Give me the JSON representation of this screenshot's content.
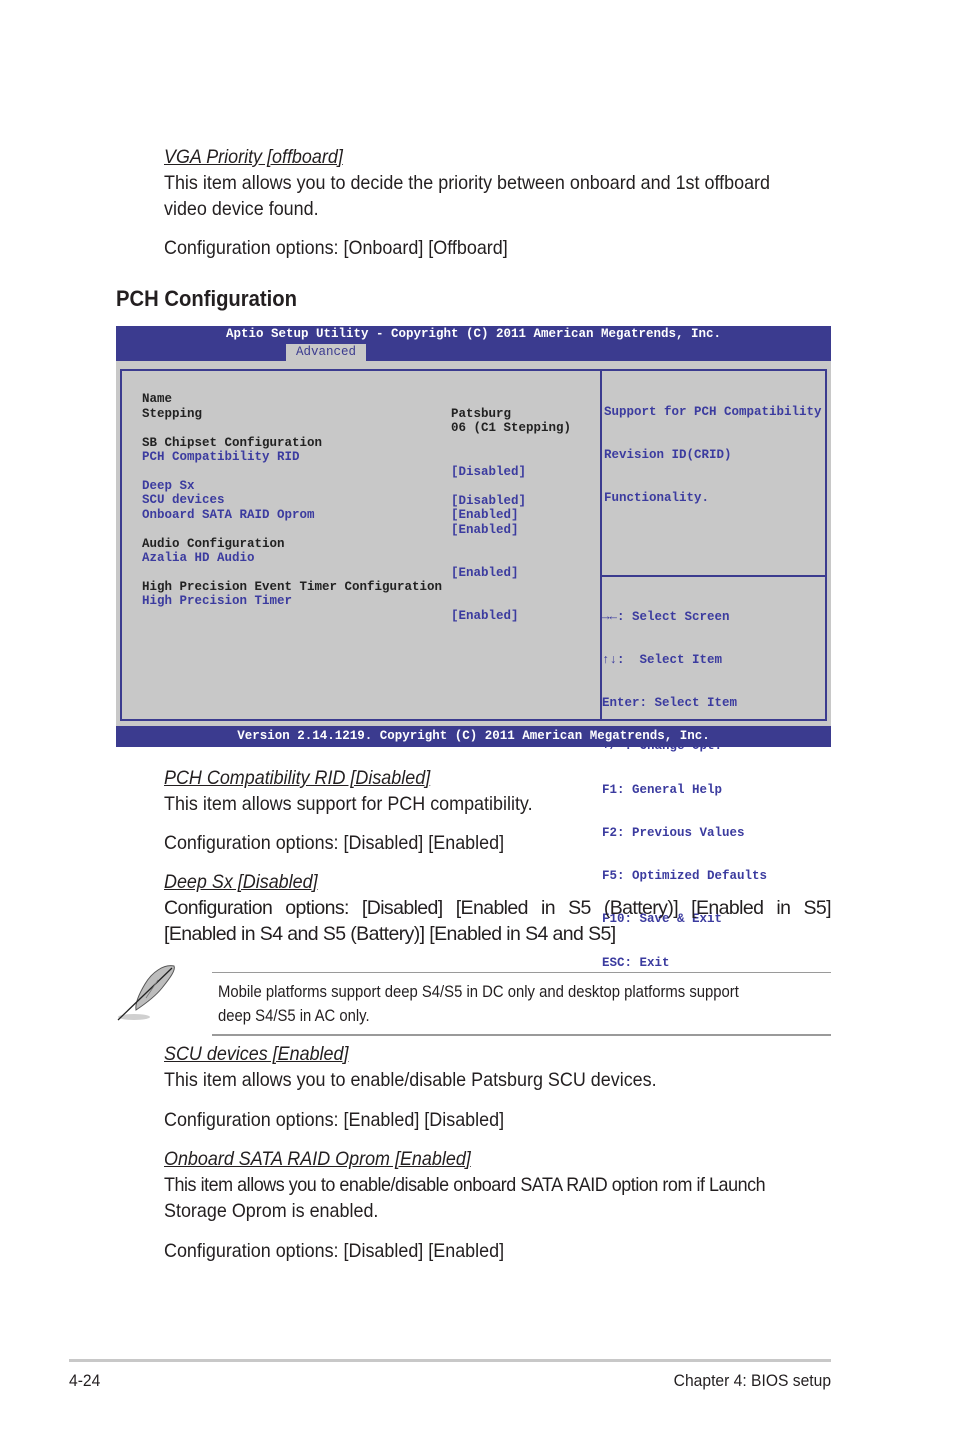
{
  "vga": {
    "title": "VGA Priority [offboard]",
    "desc_line1": "This item allows you to decide the priority between onboard and 1st offboard",
    "desc_line2": "video device found.",
    "options": "Configuration options: [Onboard] [Offboard]"
  },
  "section_heading": "PCH Configuration",
  "bios": {
    "title": "Aptio Setup Utility - Copyright (C) 2011 American Megatrends, Inc.",
    "active_tab": "Advanced",
    "rows": [
      {
        "label": "Name",
        "value": "Patsburg",
        "selectable": false
      },
      {
        "label": "Stepping",
        "value": "06 (C1 Stepping)",
        "selectable": false
      },
      {
        "label": "SB Chipset Configuration",
        "value": "",
        "selectable": false
      },
      {
        "label": "PCH Compatibility RID",
        "value": "[Disabled]",
        "selectable": true
      },
      {
        "label": "Deep Sx",
        "value": "[Disabled]",
        "selectable": true
      },
      {
        "label": "SCU devices",
        "value": "[Enabled]",
        "selectable": true
      },
      {
        "label": "Onboard SATA RAID Oprom",
        "value": "[Enabled]",
        "selectable": true
      },
      {
        "label": "Audio Configuration",
        "value": "",
        "selectable": false
      },
      {
        "label": "Azalia HD Audio",
        "value": "[Enabled]",
        "selectable": true
      },
      {
        "label": "High Precision Event Timer Configuration",
        "value": "",
        "selectable": false
      },
      {
        "label": "High Precision Timer",
        "value": "[Enabled]",
        "selectable": true
      }
    ],
    "help_lines": [
      "Support for PCH Compatibility",
      "Revision ID(CRID)",
      "Functionality."
    ],
    "key_hints": [
      "→←: Select Screen",
      "↑↓:  Select Item",
      "Enter: Select Item",
      "+/-: Change Opt.",
      "F1: General Help",
      "F2: Previous Values",
      "F5: Optimized Defaults",
      "F10: Save & Exit",
      "ESC: Exit"
    ],
    "version": "Version 2.14.1219. Copyright (C) 2011 American Megatrends, Inc.",
    "colors": {
      "bar": "#3b3b8f",
      "panel": "#c8c8c8",
      "selectable_text": "#3b3b9f"
    }
  },
  "pch_rid": {
    "title": "PCH Compatibility RID [Disabled]",
    "desc": "This item allows support for PCH compatibility.",
    "options": "Configuration options: [Disabled] [Enabled]"
  },
  "deep_sx": {
    "title": "Deep Sx [Disabled]",
    "options": "Configuration options: [Disabled] [Enabled in S5 (Battery)] [Enabled in S5] [Enabled in S4 and S5 (Battery)] [Enabled in S4 and S5]"
  },
  "note": {
    "icon": "feather-pen-icon",
    "text_line1": "Mobile platforms support deep S4/S5 in DC only and desktop platforms support",
    "text_line2": "deep S4/S5 in AC only."
  },
  "scu": {
    "title": "SCU devices [Enabled]",
    "desc": "This item allows you to enable/disable Patsburg SCU devices.",
    "options": "Configuration options: [Enabled] [Disabled]"
  },
  "sata_oprom": {
    "title": "Onboard SATA RAID Oprom [Enabled]",
    "desc_line1": "This item allows you to enable/disable onboard SATA RAID option rom if Launch",
    "desc_line2": "Storage Oprom is enabled.",
    "options": "Configuration options: [Disabled] [Enabled]"
  },
  "footer": {
    "page_number": "4-24",
    "chapter": "Chapter 4: BIOS setup"
  }
}
